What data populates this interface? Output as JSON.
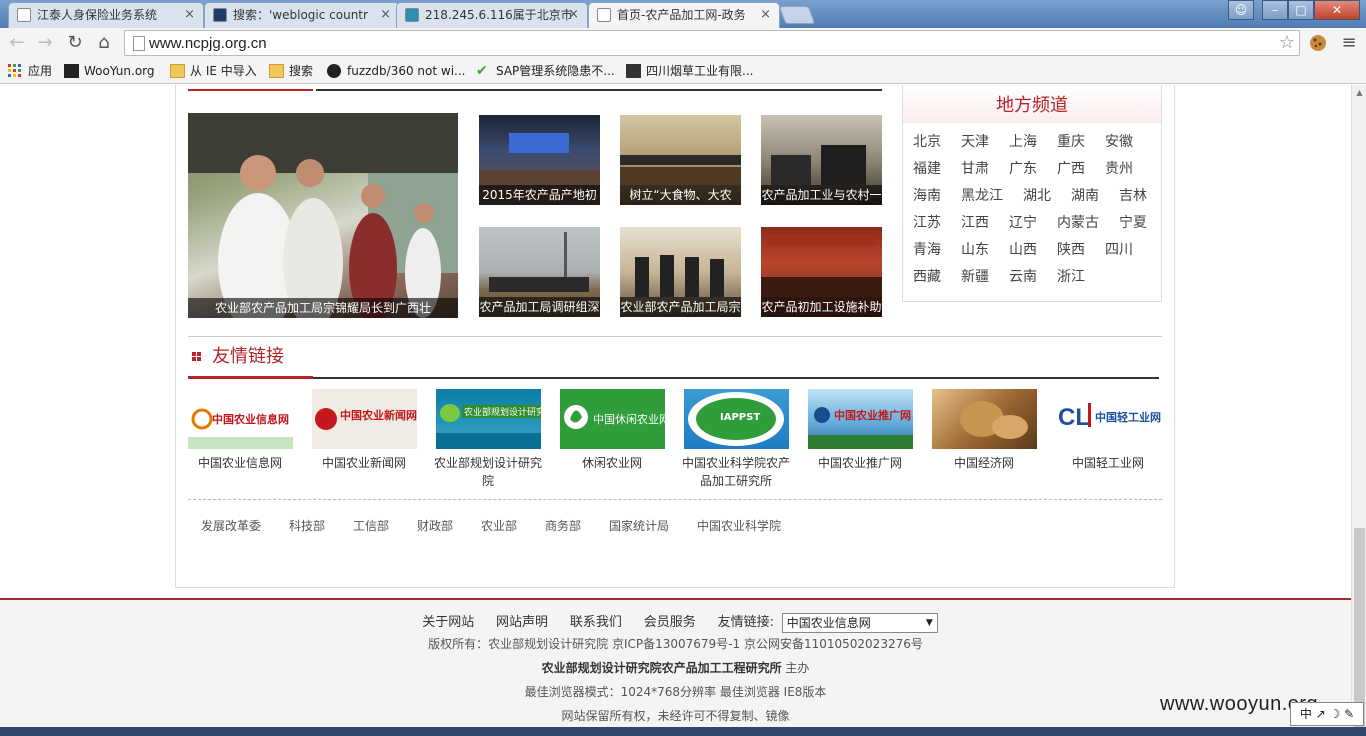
{
  "browser": {
    "tabs": [
      {
        "label": "江泰人身保险业务系统",
        "active": false
      },
      {
        "label": "搜索：'weblogic countr",
        "active": false
      },
      {
        "label": "218.245.6.116属于北京市",
        "active": false
      },
      {
        "label": "首页-农产品加工网-政务",
        "active": true
      }
    ],
    "tab_close": "×",
    "window_buttons": {
      "minimize": "–",
      "maximize": "□",
      "close": "✕"
    },
    "url": "www.ncpjg.org.cn",
    "nav": {
      "back": "←",
      "forward": "→",
      "reload": "↻",
      "home": "⌂",
      "star": "☆",
      "menu": "≡"
    },
    "bookmarks": [
      "应用",
      "WooYun.org",
      "从 IE 中导入",
      "搜索",
      "fuzzdb/360 not wi...",
      "SAP管理系统隐患不...",
      "四川烟草工业有限..."
    ]
  },
  "news": {
    "main": {
      "caption": "农业部农产品加工局宗锦耀局长到广西壮"
    },
    "thumbs": [
      {
        "caption": "2015年农产品产地初"
      },
      {
        "caption": "树立“大食物、大农"
      },
      {
        "caption": "农产品加工业与农村一"
      },
      {
        "caption": "农产品加工局调研组深"
      },
      {
        "caption": "农业部农产品加工局宗"
      },
      {
        "caption": "农产品初加工设施补助"
      }
    ]
  },
  "region": {
    "title": "地方频道",
    "items": [
      "北京",
      "天津",
      "上海",
      "重庆",
      "安徽",
      "福建",
      "甘肃",
      "广东",
      "广西",
      "贵州",
      "海南",
      "黑龙江",
      "湖北",
      "湖南",
      "吉林",
      "江苏",
      "江西",
      "辽宁",
      "内蒙古",
      "宁夏",
      "青海",
      "山东",
      "山西",
      "陕西",
      "四川",
      "西藏",
      "新疆",
      "云南",
      "浙江"
    ]
  },
  "friends": {
    "title": "友情链接",
    "logos": [
      {
        "text": "中国农业信息网",
        "label": "中国农业信息网"
      },
      {
        "text": "中国农业新闻网",
        "label": "中国农业新闻网"
      },
      {
        "text": "农业部规划设计研究院",
        "label": "农业部规划设计研究院"
      },
      {
        "text": "中国休闲农业网",
        "label": "休闲农业网"
      },
      {
        "text": "IAPPST",
        "label": "中国农业科学院农产品加工研究所"
      },
      {
        "text": "中国农业推广网",
        "label": "中国农业推广网"
      },
      {
        "text": "",
        "label": "中国经济网"
      },
      {
        "text": "中国轻工业网",
        "label": "中国轻工业网"
      }
    ],
    "gov_links": [
      "发展改革委",
      "科技部",
      "工信部",
      "财政部",
      "农业部",
      "商务部",
      "国家统计局",
      "中国农业科学院"
    ]
  },
  "footer": {
    "links": [
      "关于网站",
      "网站声明",
      "联系我们",
      "会员服务"
    ],
    "friend_label": "友情链接:",
    "select_value": "中国农业信息网",
    "copyright": "版权所有：农业部规划设计研究院 京ICP备13007679号-1 京公网安备11010502023276号",
    "host_org": "农业部规划设计研究院农产品加工工程研究所",
    "host_suffix": " 主办",
    "browser_note": "最佳浏览器模式：1024*768分辨率 最佳浏览器 IE8版本",
    "rights": "网站保留所有权，未经许可不得复制、镜像"
  },
  "watermark": "www.wooyun.org",
  "ime": "中 ↗ ☽ ✎"
}
